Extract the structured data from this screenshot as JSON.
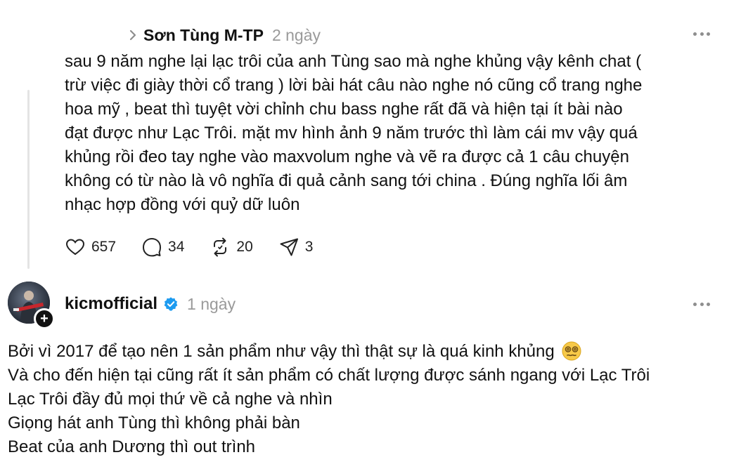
{
  "reply": {
    "author": "Sơn Tùng M-TP",
    "time": "2 ngày",
    "body": "sau 9 năm nghe lại lạc trôi của anh Tùng sao mà nghe khủng vậy kênh chat (\ntrừ việc đi giày thời cổ trang ) lời bài hát câu nào nghe nó cũng cổ trang nghe\nhoa mỹ , beat thì tuyệt vời chỉnh chu bass nghe rất đã và hiện tại ít bài nào\nđạt được như Lạc Trôi. mặt mv hình ảnh 9 năm trước thì làm cái mv vậy quá\nkhủng rồi đeo tay nghe vào maxvolum nghe và vẽ ra được cả 1 câu chuyện\nkhông có từ nào là vô nghĩa đi quả cảnh sang tới china . Đúng nghĩa lối âm\nnhạc hợp đồng với quỷ dữ luôn",
    "actions": {
      "likes": "657",
      "comments": "34",
      "reposts": "20",
      "shares": "3"
    },
    "icons": [
      "chevron-right-icon",
      "more-icon",
      "heart-icon",
      "comment-icon",
      "repost-icon",
      "share-icon"
    ]
  },
  "post": {
    "author": "kicmofficial",
    "time": "1 ngày",
    "verified": true,
    "follow_symbol": "+",
    "lines": [
      "Bởi vì 2017 để tạo nên 1 sản phẩm như vậy thì thật sự là quá kinh khủng",
      "Và cho đến hiện tại cũng rất ít sản phẩm có chất lượng được sánh ngang với Lạc Trôi",
      "Lạc Trôi đầy đủ mọi thứ về cả nghe và nhìn",
      "Giọng hát anh Tùng thì không phải bàn",
      "Beat của anh Dương thì out trình"
    ],
    "emoji": "woozy-face-emoji"
  },
  "colors": {
    "text": "#111111",
    "muted": "#9a9a9a",
    "verified": "#1d9bf0",
    "thread_line": "#e4e4e4"
  }
}
